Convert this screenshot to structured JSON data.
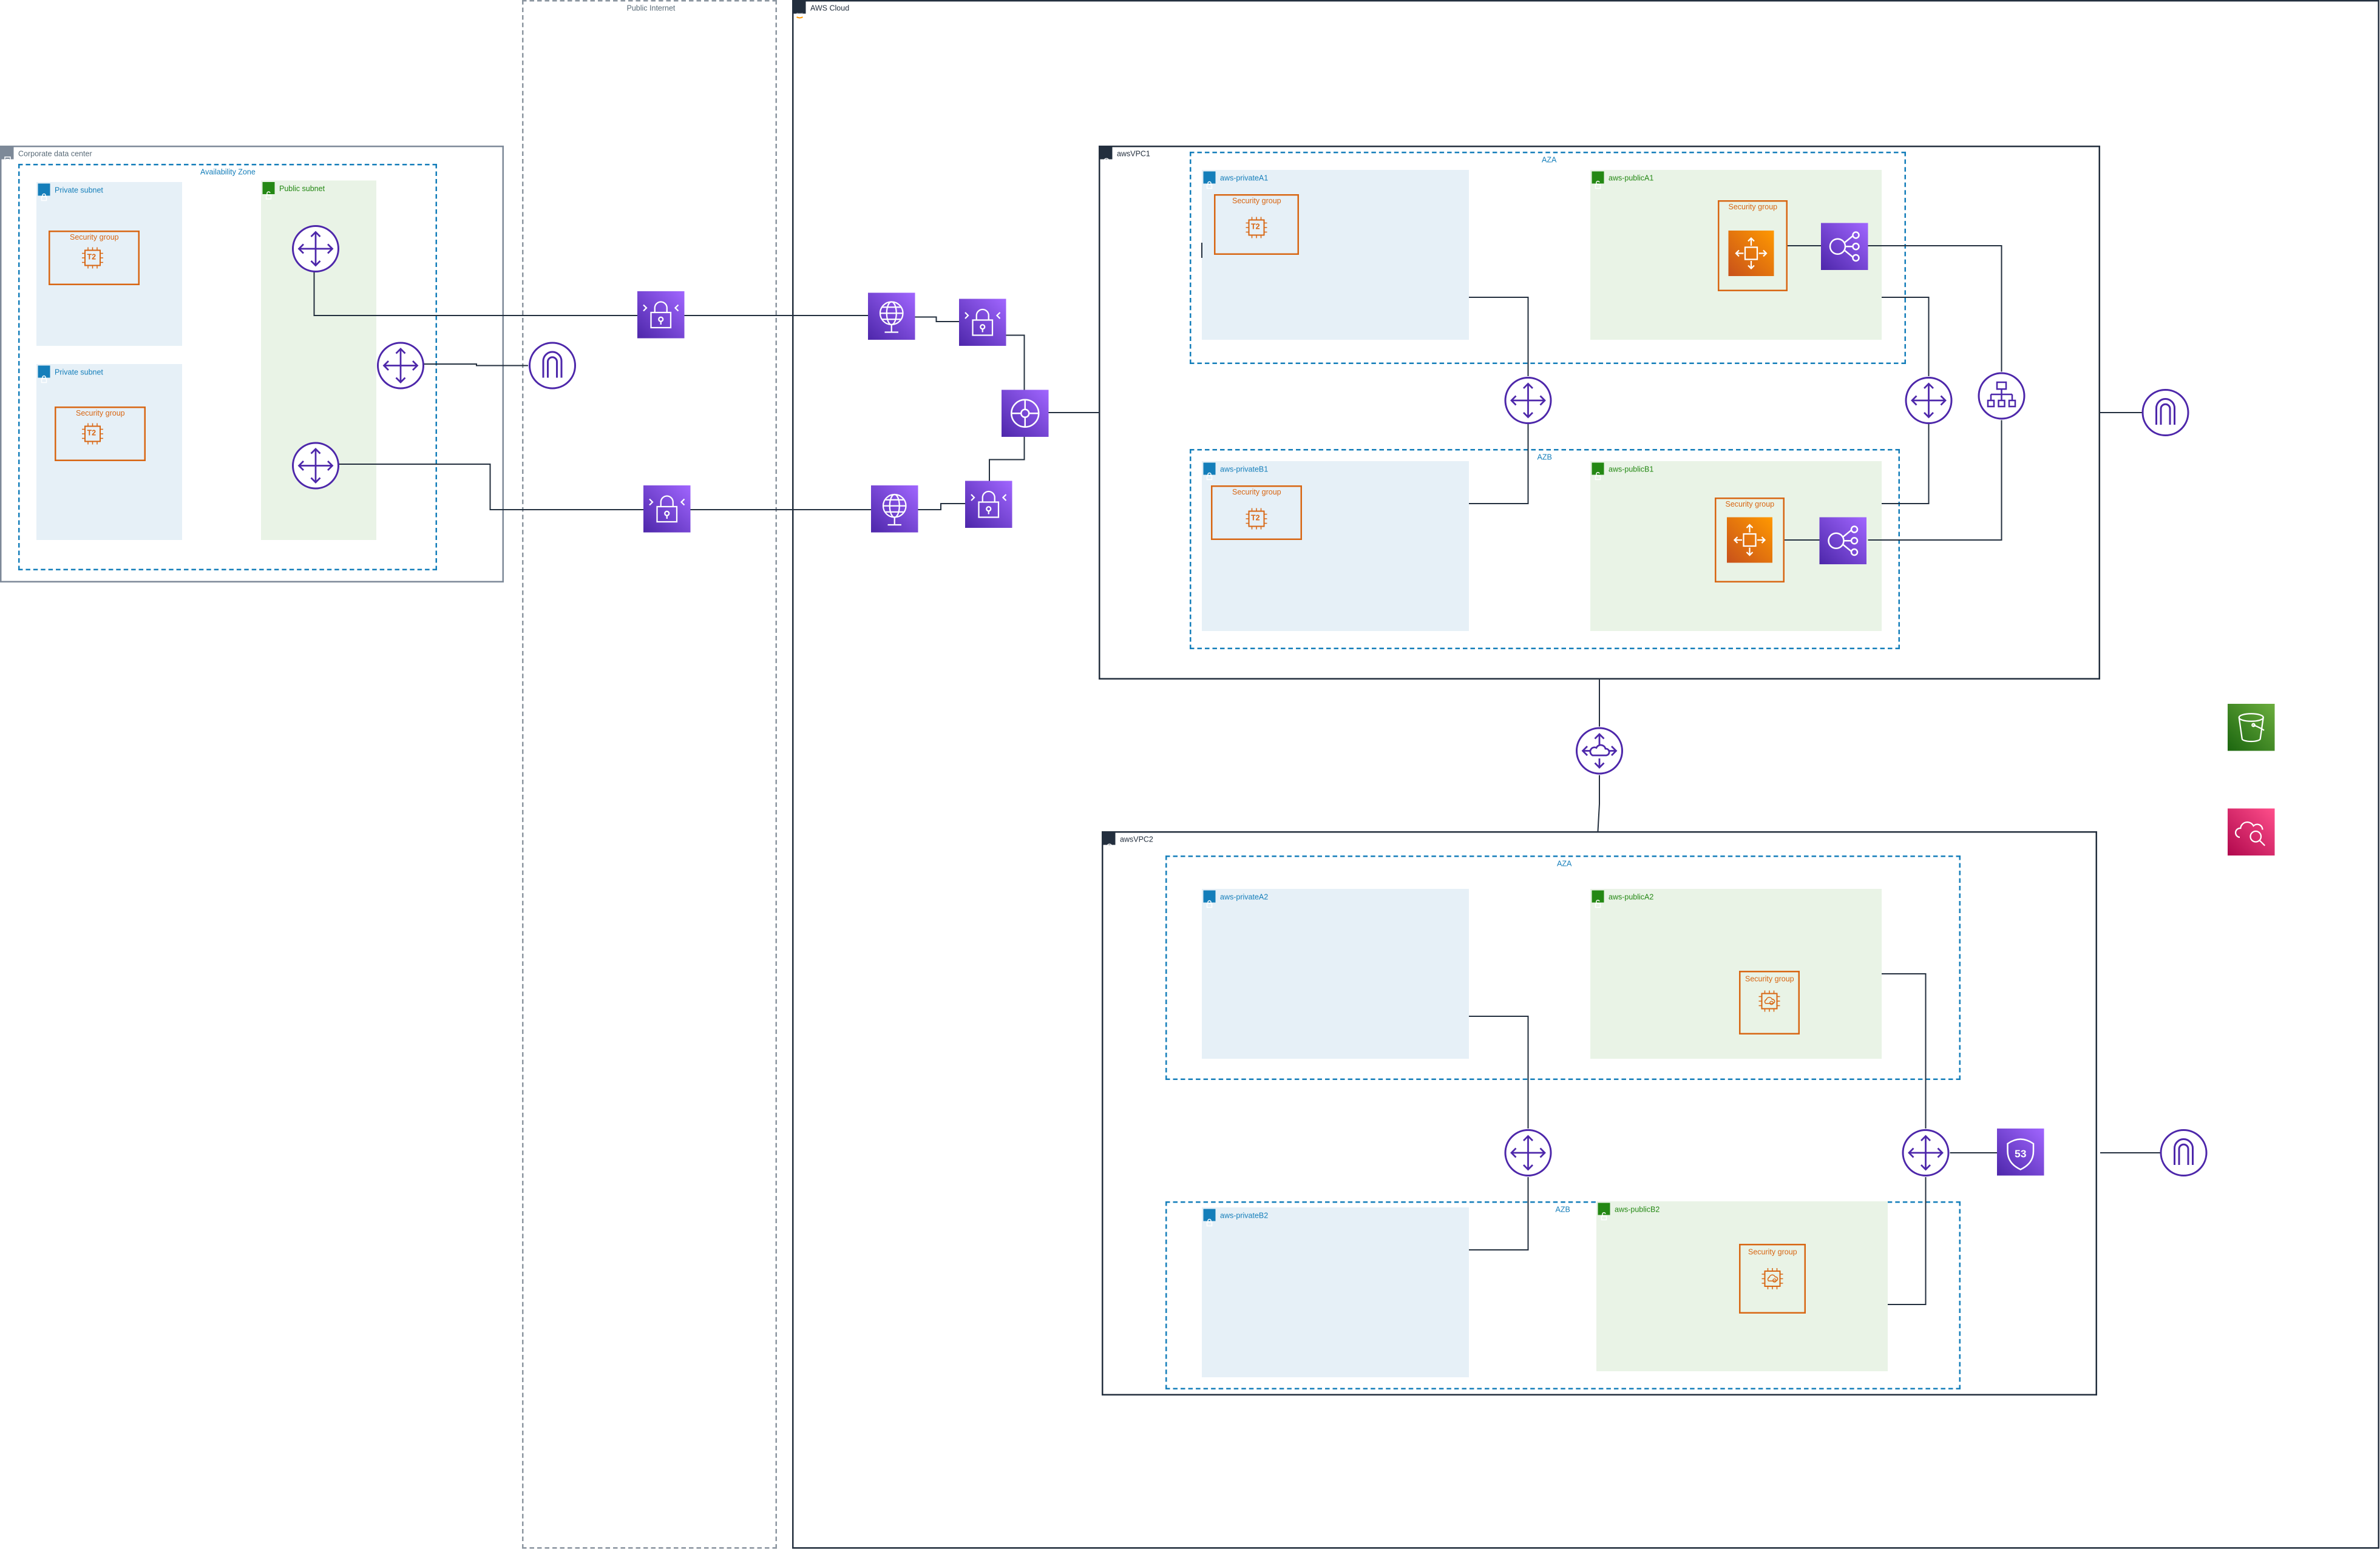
{
  "containers": {
    "public_internet": "Public Internet",
    "aws_cloud": "AWS Cloud",
    "corporate_dc": "Corporate data center",
    "corp_az": "Availability Zone",
    "corp_private_subnet_1": "Private subnet",
    "corp_private_subnet_2": "Private subnet",
    "corp_public_subnet": "Public subnet",
    "vpc1": "awsVPC1",
    "vpc1_aza": "AZA",
    "vpc1_azb": "AZB",
    "vpc1_private_a1": "aws-privateA1",
    "vpc1_public_a1": "aws-publicA1",
    "vpc1_private_b1": "aws-privateB1",
    "vpc1_public_b1": "aws-publicB1",
    "vpc2": "awsVPC2",
    "vpc2_aza": "AZA",
    "vpc2_azb": "AZB",
    "vpc2_private_a2": "aws-privateA2",
    "vpc2_public_a2": "aws-publicA2",
    "vpc2_private_b2": "aws-privateB2",
    "vpc2_public_b2": "aws-publicB2"
  },
  "security_group_label": "Security group",
  "instance_label": "T2",
  "colors": {
    "network": "#4d27aa",
    "network_gradient_top": "#a166ff",
    "network_gradient_bottom": "#5a30b5",
    "compute": "#d86613",
    "compute_gradient_top": "#f78e04",
    "storage": "#3f8624",
    "management": "#e7157b",
    "private_subnet": "#e6f0f7",
    "public_subnet": "#e9f3e6",
    "az_border": "#147eba",
    "public_label": "#248814"
  },
  "icons": [
    "router-icon",
    "internet-gateway-icon",
    "vpn-gateway-icon",
    "client-vpn-icon",
    "transit-gateway-icon",
    "network-load-balancer-icon",
    "application-load-balancer-icon",
    "auto-scaling-icon",
    "ec2-t2-instance-icon",
    "ec2-instance-icon",
    "transit-gateway-attachment-icon",
    "route53-icon",
    "s3-bucket-icon",
    "cloudwatch-icon"
  ]
}
